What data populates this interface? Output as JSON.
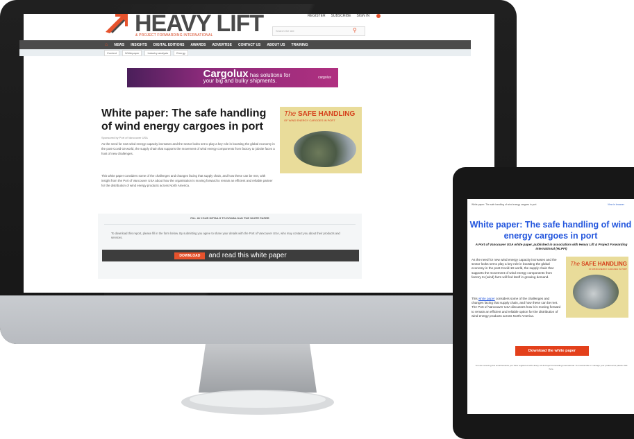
{
  "desktop": {
    "header": {
      "logo_text": "HEAVY LIFT",
      "logo_tagline": "& PROJECT FORWARDING INTERNATIONAL",
      "top_links": [
        "REGISTER",
        "SUBSCRIBE",
        "SIGN IN"
      ],
      "search_placeholder": "Search the site"
    },
    "nav": {
      "items": [
        "NEWS",
        "INSIGHTS",
        "DIGITAL EDITIONS",
        "AWARDS",
        "ADVERTISE",
        "CONTACT US",
        "ABOUT US",
        "TRAINING"
      ]
    },
    "breadcrumb": [
      "Content",
      "Whitepaper",
      "Industry analysis",
      "Energy"
    ],
    "banner": {
      "brand": "Cargolux",
      "text_1": " has solutions for",
      "text_2": "your big and bulky shipments.",
      "logo": "cargolux"
    },
    "article": {
      "title": "White paper: The safe handling of wind energy cargoes in port",
      "byline": "Sponsored by Port of Vancouver USA",
      "para_1": "As the need for new wind energy capacity increases and the sector looks set to play a key role in boosting the global economy in the post-Covid-19 world, the supply chain that supports the movement of wind energy components from factory to jobsite faces a host of new challenges.",
      "para_2": "This white paper considers some of the challenges and changes facing that supply chain, and how these can be met, with insight from the Port of Vancouver USA about how the organisation is moving forward to remain an efficient and reliable partner for the distribution of wind energy products across North America."
    },
    "cover": {
      "title_the": "The ",
      "title_main": "SAFE HANDLING",
      "subtitle": "OF WIND ENERGY CARGOES IN PORT"
    },
    "gate": {
      "heading": "FILL IN YOUR DETAILS TO DOWNLOAD THE WHITE PAPER",
      "text": "To download this report, please fill in the form below. By submitting you agree to share your details with the Port of Vancouver USA, who may contact you about their products and services.",
      "button": "DOWNLOAD",
      "button_suffix": "and read this white paper"
    }
  },
  "tablet": {
    "crumb": "White paper: The safe handling of wind energy cargoes in port",
    "top_link": "View in browser",
    "title": "White paper: The safe handling of wind energy cargoes in port",
    "subtitle": "A Port of Vancouver USA white paper, published in association with Heavy Lift & Project Forwarding International (HLPFI)",
    "para_1": "As the need for new wind energy capacity increases and the sector looks set to play a key role in boosting the global economy in the post-Covid-19 world, the supply chain that supports the movement of wind energy components from factory to (wind) farm will find itself in growing demand.",
    "para_2_pre": "This ",
    "para_2_link": "white paper",
    "para_2_post": " considers some of the challenges and changes facing that supply chain, and how these can be met. The Port of Vancouver USA discusses how it is moving forward to remain an efficient and reliable option for the distribution of wind energy products across North America.",
    "cover_title_the": "The ",
    "cover_title_main": "SAFE HANDLING",
    "cover_subtitle": "OF WIND ENERGY CARGOES IN PORT",
    "button": "Download the white paper",
    "footer": "You are receiving this email because you have registered with Heavy Lift & Project Forwarding International. To unsubscribe or manage your preferences please click here."
  },
  "colors": {
    "accent": "#e6522c",
    "nav": "#4b4b4b",
    "tablet_title": "#2255dd",
    "cover_bg": "#e9dc9a"
  }
}
